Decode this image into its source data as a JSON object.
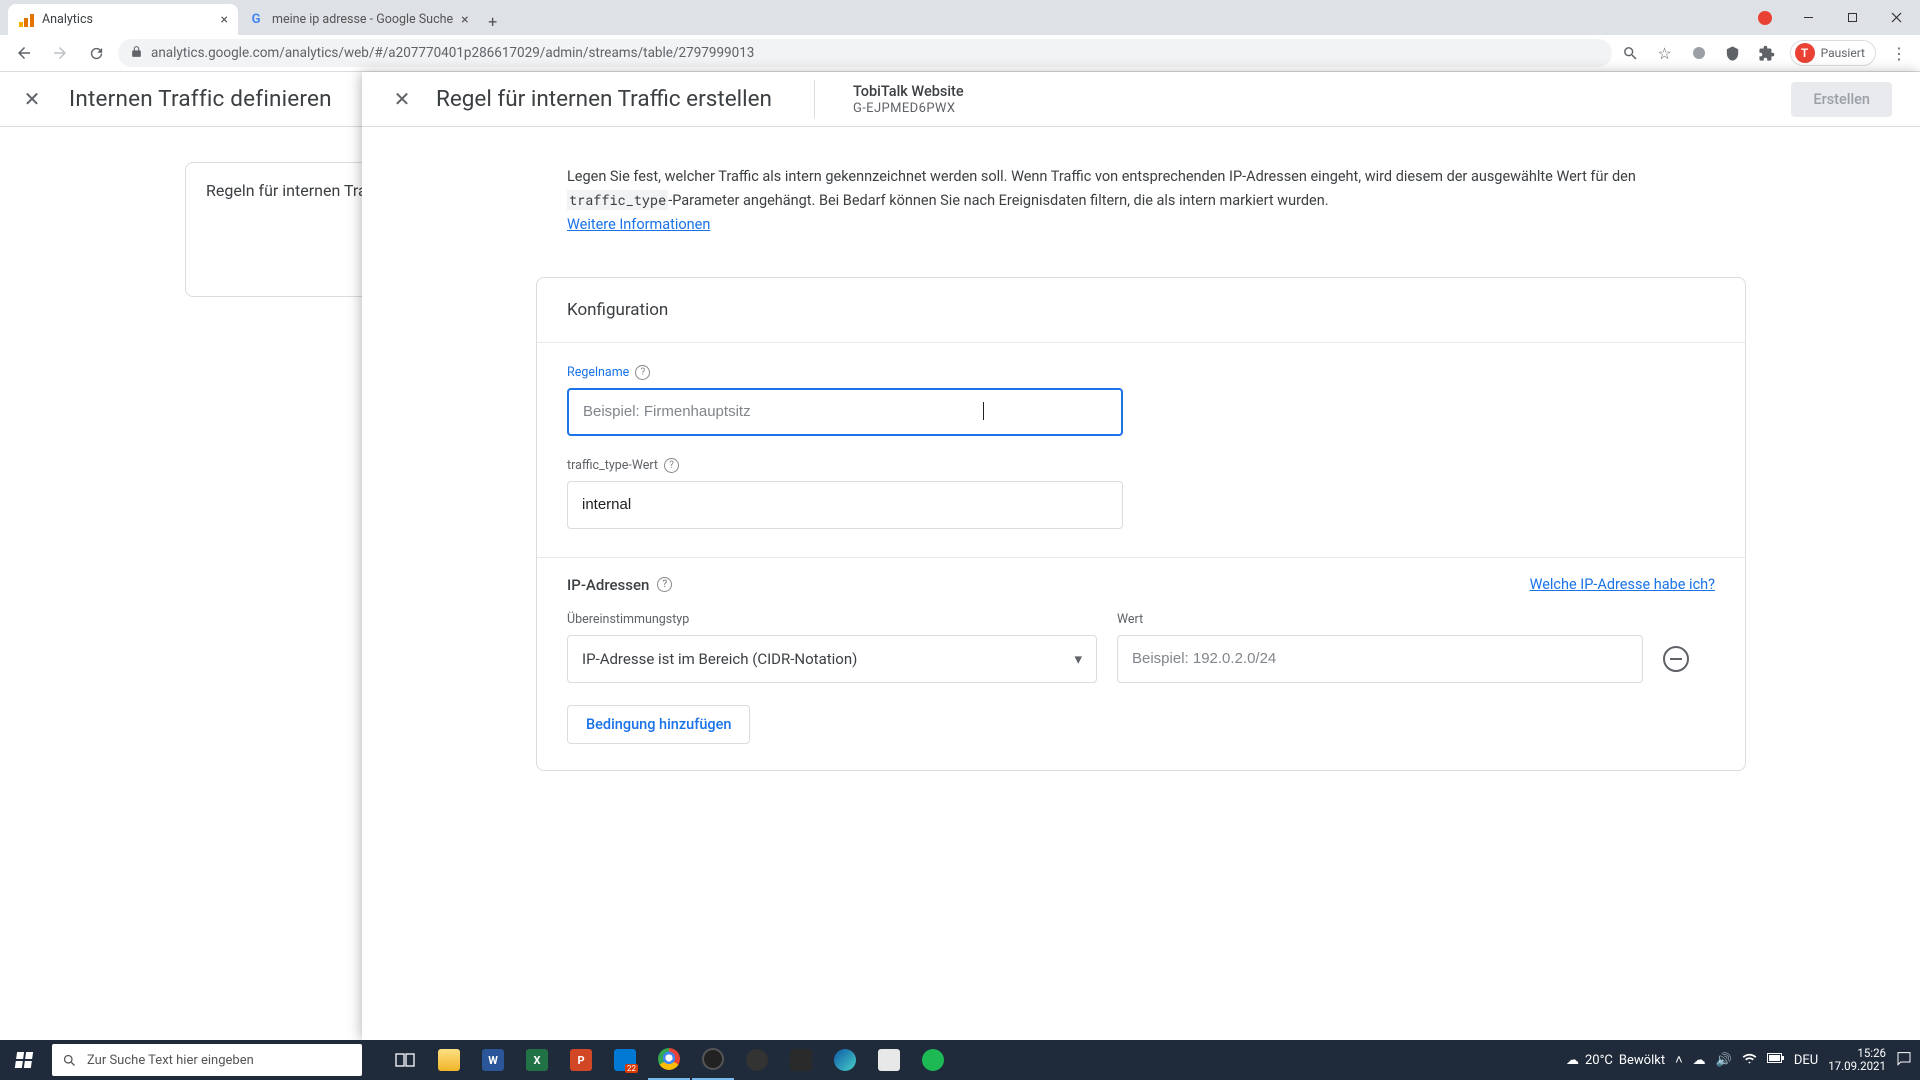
{
  "browser": {
    "tabs": [
      {
        "title": "Analytics",
        "active": true
      },
      {
        "title": "meine ip adresse - Google Suche",
        "active": false
      }
    ],
    "url": "analytics.google.com/analytics/web/#/a207770401p286617029/admin/streams/table/2797999013",
    "profile_badge": "T",
    "profile_state": "Pausiert"
  },
  "background": {
    "header_title": "Internen Traffic definieren",
    "card_title": "Regeln für internen Traffic"
  },
  "modal": {
    "title": "Regel für internen Traffic erstellen",
    "stream_name": "TobiTalk Website",
    "stream_id": "G-EJPMED6PWX",
    "create_btn": "Erstellen",
    "intro_pre": "Legen Sie fest, welcher Traffic als intern gekennzeichnet werden soll. Wenn Traffic von entsprechenden IP-Adressen eingeht, wird diesem der ausgewählte Wert für den ",
    "intro_code": "traffic_type",
    "intro_post": "-Parameter angehängt. Bei Bedarf können Sie nach Ereignisdaten filtern, die als intern markiert wurden.",
    "more_info": "Weitere Informationen",
    "card_title": "Konfiguration",
    "rule_name_label": "Regelname",
    "rule_name_placeholder": "Beispiel: Firmenhauptsitz",
    "traffic_type_label": "traffic_type-Wert",
    "traffic_type_value": "internal",
    "ip_section_title": "IP-Adressen",
    "which_ip_link": "Welche IP-Adresse habe ich?",
    "match_type_label": "Übereinstimmungstyp",
    "match_type_value": "IP-Adresse ist im Bereich (CIDR-Notation)",
    "value_label": "Wert",
    "value_placeholder": "Beispiel: 192.0.2.0/24",
    "add_condition_btn": "Bedingung hinzufügen"
  },
  "taskbar": {
    "search_placeholder": "Zur Suche Text hier eingeben",
    "weather_temp": "20°C",
    "weather_desc": "Bewölkt",
    "lang": "DEU",
    "time": "15:26",
    "date": "17.09.2021"
  }
}
